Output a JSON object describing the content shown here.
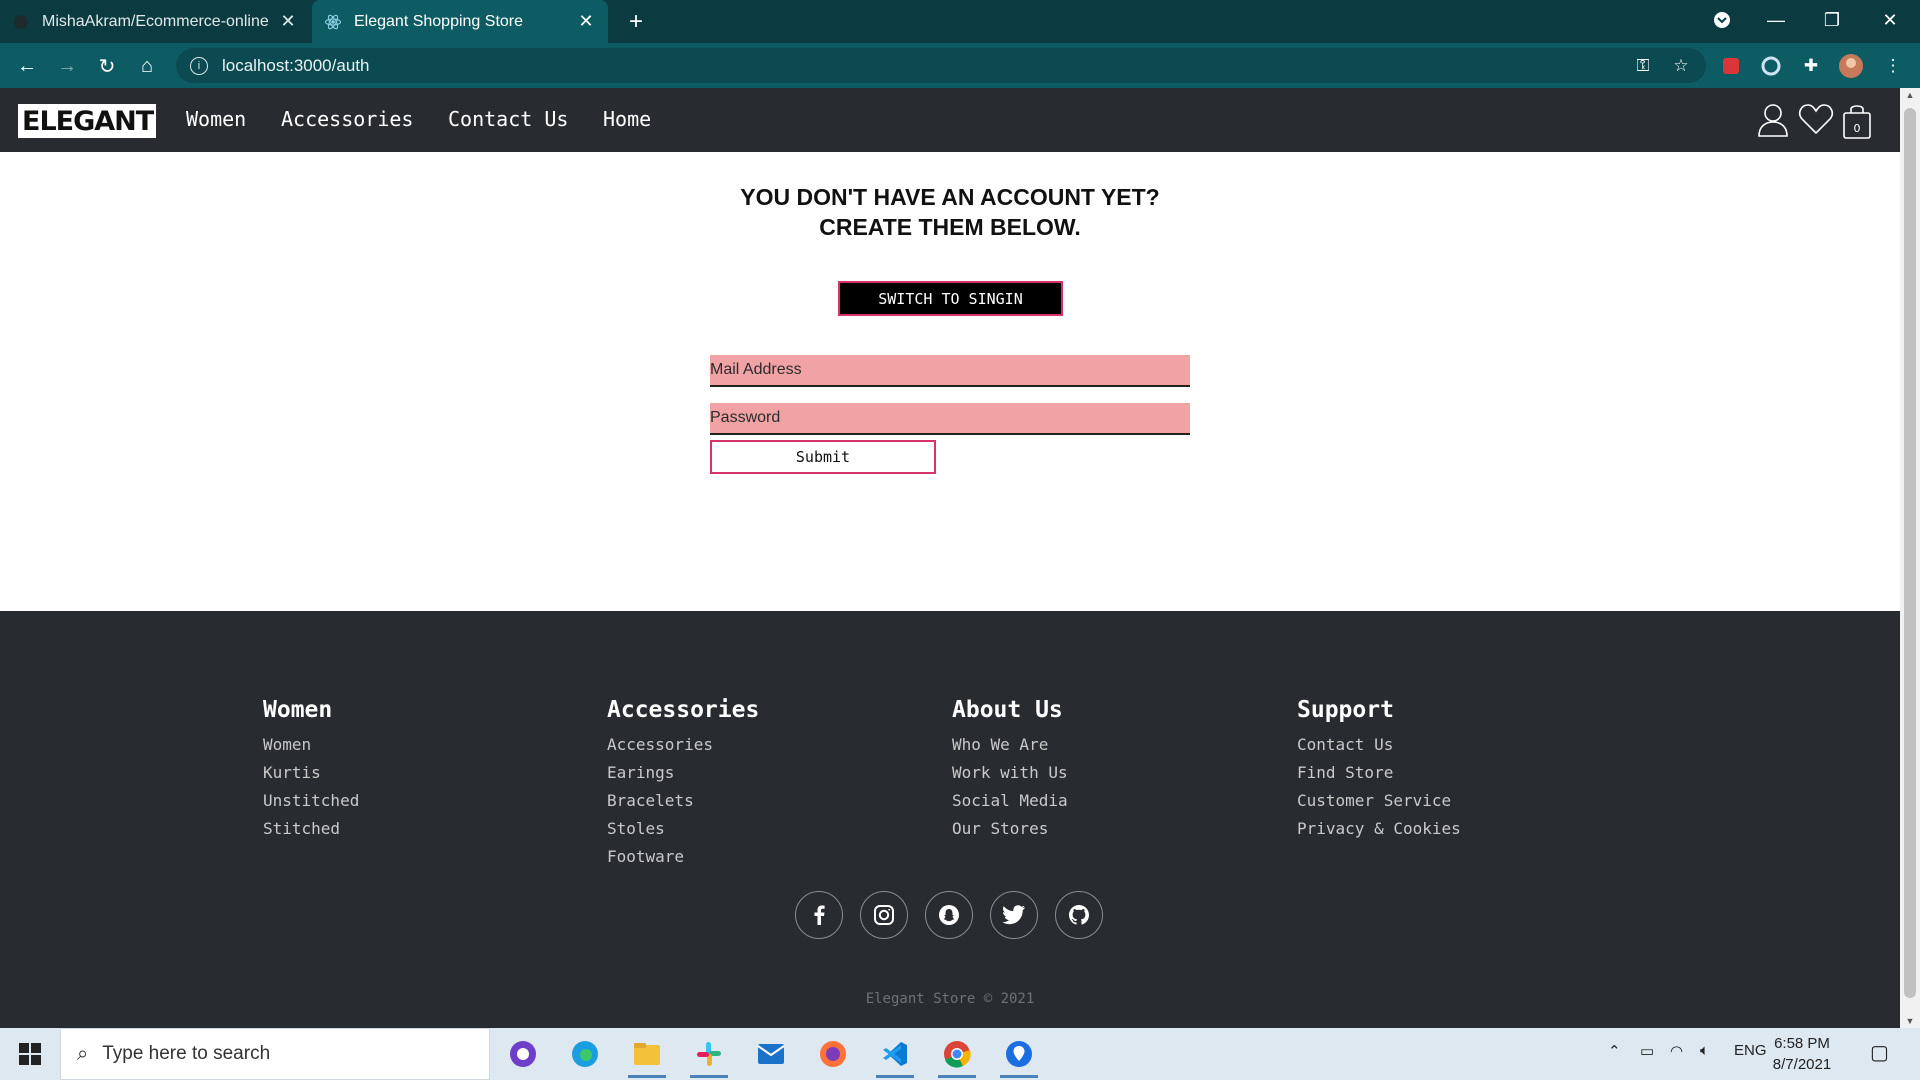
{
  "browser": {
    "tabs": [
      {
        "title": "MishaAkram/Ecommerce-online",
        "active": false
      },
      {
        "title": "Elegant Shopping Store",
        "active": true
      }
    ],
    "url": "localhost:3000/auth"
  },
  "site": {
    "logo_text": "ELEGANT",
    "nav": [
      "Women",
      "Accessories",
      "Contact Us",
      "Home"
    ],
    "cart_count": "0"
  },
  "auth": {
    "heading_line1": "YOU DON'T HAVE AN ACCOUNT YET?",
    "heading_line2": "CREATE THEM BELOW.",
    "switch_label": "SWITCH TO SINGIN",
    "email_placeholder": "Mail Address",
    "password_placeholder": "Password",
    "submit_label": "Submit"
  },
  "footer": {
    "columns": [
      {
        "title": "Women",
        "links": [
          "Women",
          "Kurtis",
          "Unstitched",
          "Stitched"
        ]
      },
      {
        "title": "Accessories",
        "links": [
          "Accessories",
          "Earings",
          "Bracelets",
          "Stoles",
          "Footware"
        ]
      },
      {
        "title": "About Us",
        "links": [
          "Who We Are",
          "Work with Us",
          "Social Media",
          "Our Stores"
        ]
      },
      {
        "title": "Support",
        "links": [
          "Contact Us",
          "Find Store",
          "Customer Service",
          "Privacy & Cookies"
        ]
      }
    ],
    "social": [
      "facebook-icon",
      "instagram-icon",
      "snapchat-icon",
      "twitter-icon",
      "github-icon"
    ],
    "copyright": "Elegant Store © 2021"
  },
  "taskbar": {
    "search_placeholder": "Type here to search",
    "language": "ENG",
    "time": "6:58 PM",
    "date": "8/7/2021"
  },
  "colors": {
    "chrome_dark": "#0b3b40",
    "chrome_toolbar": "#0e5c63",
    "site_nav": "#282c30",
    "input_bg": "#f1a2a4",
    "accent_border": "#d6336c"
  }
}
